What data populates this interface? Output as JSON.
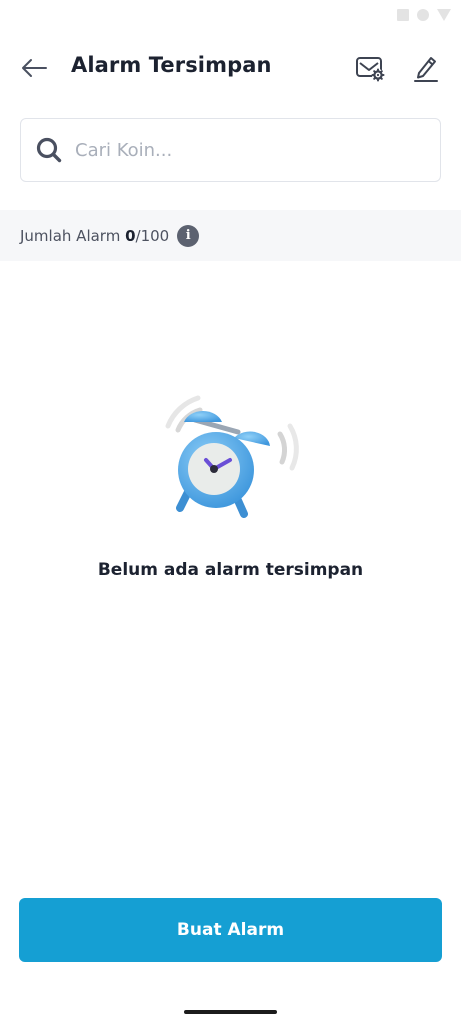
{
  "header": {
    "title": "Alarm Tersimpan"
  },
  "search": {
    "placeholder": "Cari Koin..."
  },
  "alarm_count": {
    "label": "Jumlah Alarm ",
    "current": "0",
    "max": "/100"
  },
  "empty_state": {
    "message": "Belum ada alarm tersimpan"
  },
  "actions": {
    "create_label": "Buat Alarm"
  },
  "colors": {
    "primary": "#159fd3",
    "text": "#1c2230",
    "alarm_blue": "#4da7e8",
    "alarm_hands": "#6a4fd6"
  },
  "icons": [
    "back-arrow-icon",
    "alarm-settings-icon",
    "edit-pencil-icon",
    "search-icon",
    "info-icon",
    "alarm-clock-illustration"
  ]
}
